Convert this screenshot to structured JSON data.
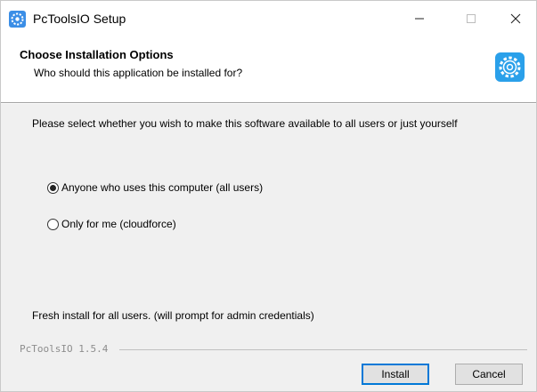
{
  "window": {
    "title": "PcToolsIO Setup",
    "minimize_glyph": "—",
    "maximize_glyph": "☐",
    "close_glyph": "✕"
  },
  "header": {
    "title": "Choose Installation Options",
    "subtitle": "Who should this application be installed for?"
  },
  "body": {
    "description": "Please select whether you wish to make this software available to all users or just yourself",
    "options": [
      {
        "label": "Anyone who uses this computer (all users)",
        "selected": true
      },
      {
        "label": "Only for me (cloudforce)",
        "selected": false
      }
    ],
    "status": "Fresh install for all users. (will prompt for admin credentials)"
  },
  "footer": {
    "brand": "PcToolsIO 1.5.4",
    "install_label": "Install",
    "cancel_label": "Cancel"
  },
  "icons": {
    "app": "gear-icon",
    "header": "gear-icon"
  },
  "colors": {
    "accent": "#0078d7",
    "icon_blue": "#2aa0ea"
  }
}
